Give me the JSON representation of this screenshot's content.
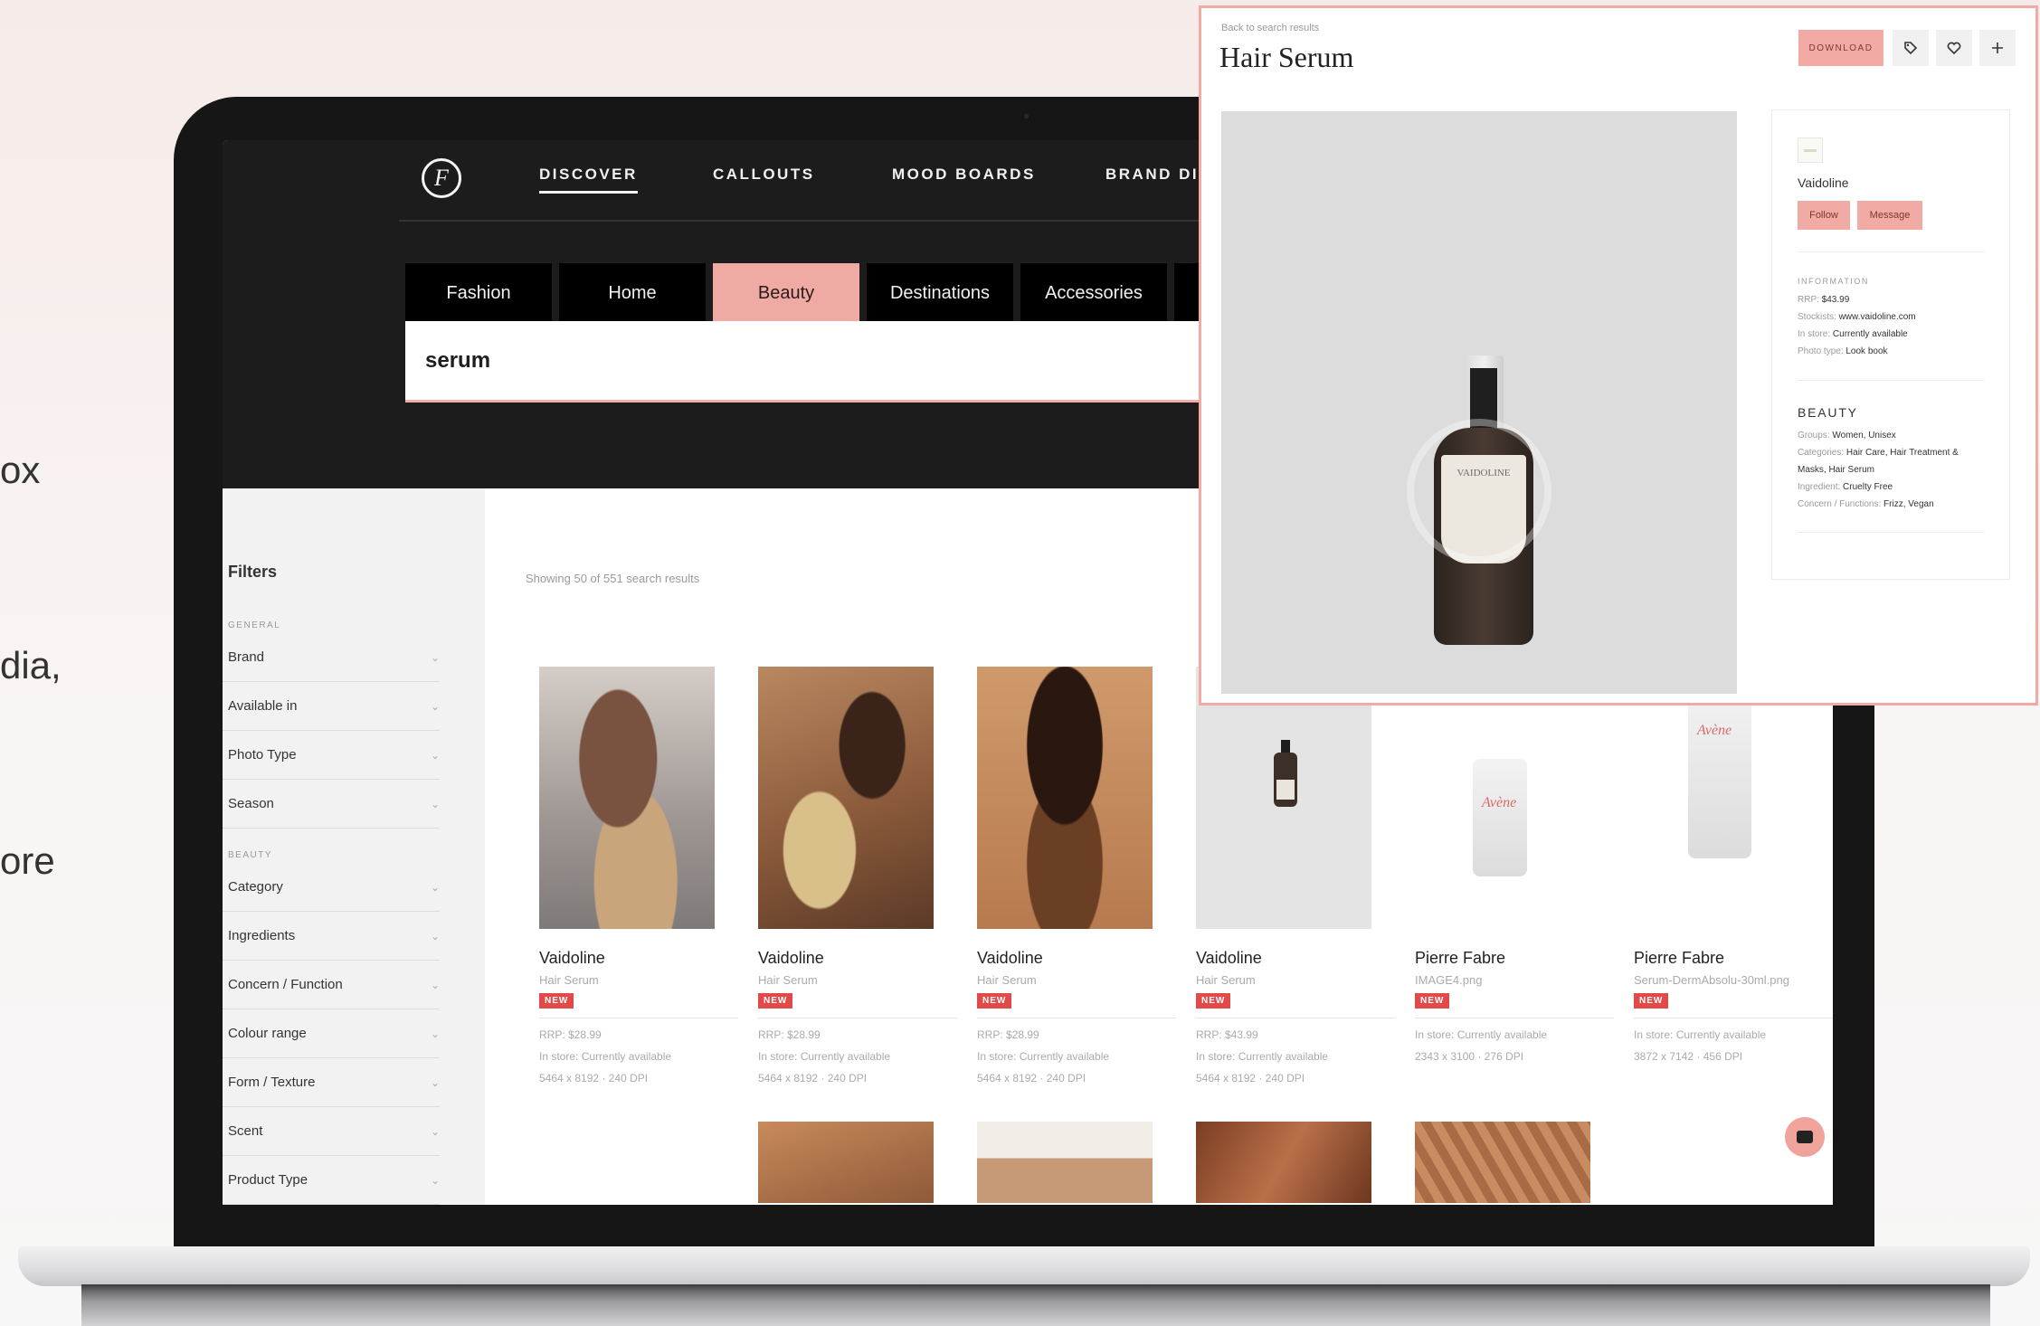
{
  "background_text": [
    "ox",
    "dia,",
    "ore"
  ],
  "nav": {
    "items": [
      "DISCOVER",
      "CALLOUTS",
      "MOOD BOARDS",
      "BRAND DIR"
    ],
    "active": "DISCOVER"
  },
  "category_tabs": [
    "Fashion",
    "Home",
    "Beauty",
    "Destinations",
    "Accessories"
  ],
  "active_category": "Beauty",
  "search": {
    "value": "serum"
  },
  "filters": {
    "title": "Filters",
    "general_label": "GENERAL",
    "general": [
      "Brand",
      "Available in",
      "Photo Type",
      "Season"
    ],
    "beauty_label": "BEAUTY",
    "beauty": [
      "Category",
      "Ingredients",
      "Concern / Function",
      "Colour range",
      "Form / Texture",
      "Scent",
      "Product Type"
    ]
  },
  "results_count": "Showing 50 of 551 search results",
  "products": [
    {
      "brand": "Vaidoline",
      "subtitle": "Hair Serum",
      "badge": "NEW",
      "rrp": "RRP: $28.99",
      "store": "In store: Currently available",
      "dims": "5464 x 8192 · 240 DPI"
    },
    {
      "brand": "Vaidoline",
      "subtitle": "Hair Serum",
      "badge": "NEW",
      "rrp": "RRP: $28.99",
      "store": "In store: Currently available",
      "dims": "5464 x 8192 · 240 DPI"
    },
    {
      "brand": "Vaidoline",
      "subtitle": "Hair Serum",
      "badge": "NEW",
      "rrp": "RRP: $28.99",
      "store": "In store: Currently available",
      "dims": "5464 x 8192 · 240 DPI"
    },
    {
      "brand": "Vaidoline",
      "subtitle": "Hair Serum",
      "badge": "NEW",
      "rrp": "RRP: $43.99",
      "store": "In store: Currently available",
      "dims": "5464 x 8192 · 240 DPI"
    },
    {
      "brand": "Pierre Fabre",
      "subtitle": "IMAGE4.png",
      "badge": "NEW",
      "store": "In store: Currently available",
      "dims": "2343 x 3100 · 276 DPI",
      "label": "Avène"
    },
    {
      "brand": "Pierre Fabre",
      "subtitle": "Serum-DermAbsolu-30ml.png",
      "badge": "NEW",
      "store": "In store: Currently available",
      "dims": "3872 x 7142 · 456 DPI",
      "label": "Avène"
    }
  ],
  "detail": {
    "back": "Back to search results",
    "title": "Hair Serum",
    "download": "DOWNLOAD",
    "icons": [
      "tag-icon",
      "heart-icon",
      "plus-icon"
    ],
    "bottle_label": "VAIDOLINE",
    "seller": "Vaidoline",
    "follow": "Follow",
    "message": "Message",
    "information_label": "INFORMATION",
    "info": [
      {
        "k": "RRP:",
        "v": "$43.99"
      },
      {
        "k": "Stockists:",
        "v": "www.vaidoline.com"
      },
      {
        "k": "In store:",
        "v": "Currently available"
      },
      {
        "k": "Photo type:",
        "v": "Look book"
      }
    ],
    "beauty_label": "BEAUTY",
    "beauty": [
      {
        "k": "Groups:",
        "v": "Women, Unisex"
      },
      {
        "k": "Categories:",
        "v": "Hair Care, Hair Treatment & Masks, Hair Serum"
      },
      {
        "k": "Ingredient:",
        "v": "Cruelty Free"
      },
      {
        "k": "Concern / Functions:",
        "v": "Frizz, Vegan"
      }
    ]
  },
  "colors": {
    "accent": "#f2aaa4",
    "dark": "#1c1c1c",
    "badge": "#e24a4a"
  }
}
